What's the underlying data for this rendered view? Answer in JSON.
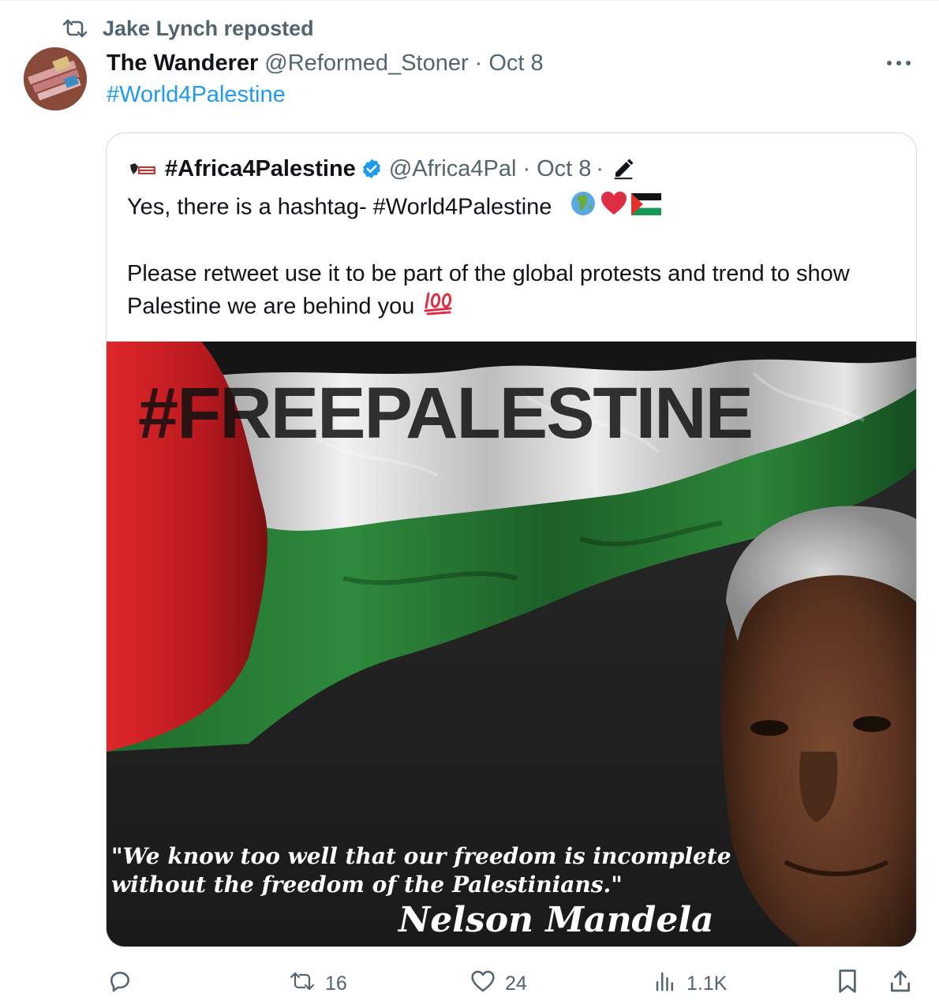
{
  "repost": {
    "text": "Jake Lynch reposted",
    "icon": "repost-icon"
  },
  "post": {
    "author_name": "The Wanderer",
    "handle": "@Reformed_Stoner",
    "separator": "·",
    "date": "Oct 8",
    "text": "#World4Palestine"
  },
  "quote": {
    "name": "#Africa4Palestine",
    "handle": "@Africa4Pal",
    "separator": "·",
    "date": "Oct 8",
    "separator2": "·",
    "line1": "Yes, there is a hashtag- #World4Palestine",
    "line2": "Please retweet use it to be part of the global protests and trend to show Palestine we are behind you",
    "emojis": [
      "globe-africa",
      "red-heart",
      "palestine-flag",
      "hundred-points"
    ],
    "image": {
      "headline": "#FREEPALESTINE",
      "quote_line1": "\"We know too well that our freedom is incomplete",
      "quote_line2": "without the freedom of the Palestinians.\"",
      "attribution": "Nelson Mandela"
    }
  },
  "actions": {
    "reply": {
      "icon": "reply-icon",
      "count": ""
    },
    "repost": {
      "icon": "repost-icon",
      "count": "16"
    },
    "like": {
      "icon": "heart-icon",
      "count": "24"
    },
    "views": {
      "icon": "views-icon",
      "count": "1.1K"
    },
    "bookmark": {
      "icon": "bookmark-icon"
    },
    "share": {
      "icon": "share-icon"
    }
  },
  "colors": {
    "accent": "#1d9bf0",
    "muted": "#536471",
    "text": "#0f1419",
    "border": "#cfd9de"
  }
}
